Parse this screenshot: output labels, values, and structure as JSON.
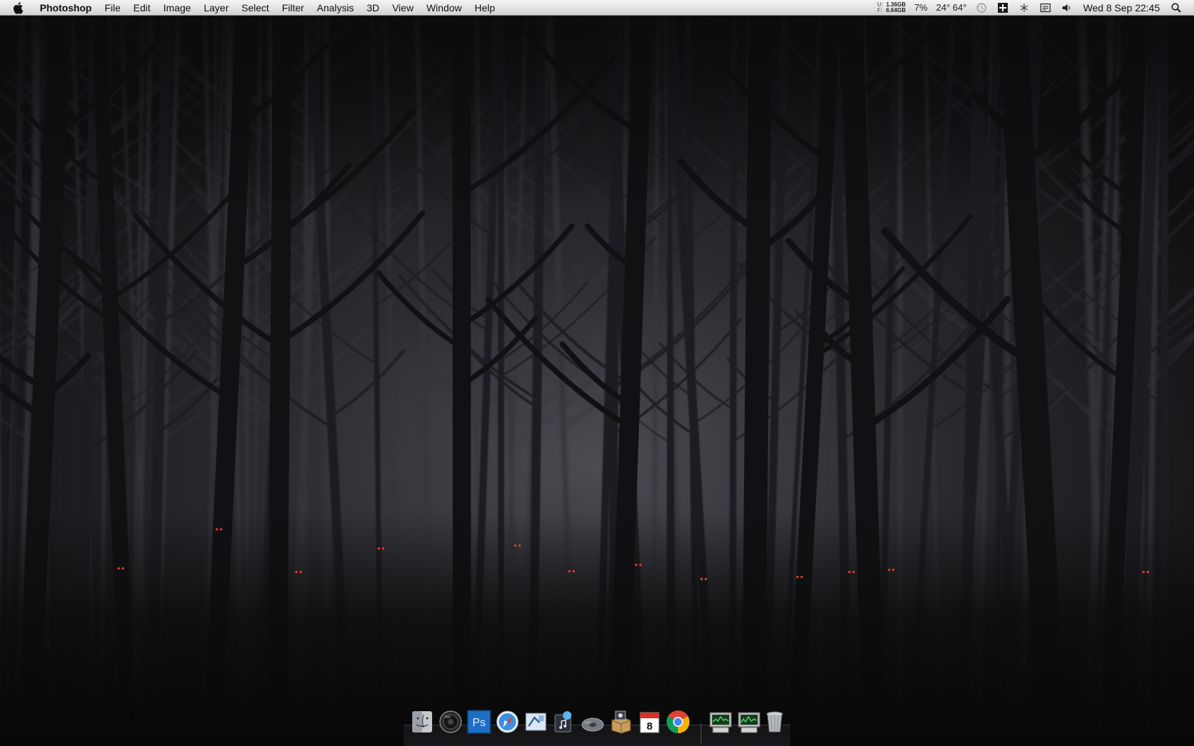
{
  "menubar": {
    "app_name": "Photoshop",
    "menus": [
      "File",
      "Edit",
      "Image",
      "Layer",
      "Select",
      "Filter",
      "Analysis",
      "3D",
      "View",
      "Window",
      "Help"
    ],
    "status": {
      "memory": {
        "label_used": "U:",
        "label_free": "F:",
        "used": "1.36GB",
        "free": "6.64GB"
      },
      "cpu": "7%",
      "temperatures": "24° 64°",
      "clock": "Wed 8 Sep  22:45"
    }
  },
  "icons": {
    "apple_menu": "apple-icon",
    "time_machine": "time-machine-icon",
    "menu_extra": "menu-extra-icon",
    "bluetooth": "bluetooth-icon",
    "input_menu": "input-menu-icon",
    "volume": "volume-icon",
    "spotlight": "spotlight-icon"
  },
  "dock": {
    "items": [
      {
        "name": "finder",
        "icon": "finder-icon"
      },
      {
        "name": "speaker",
        "icon": "speaker-icon"
      },
      {
        "name": "photoshop",
        "icon": "photoshop-icon",
        "label": "Ps"
      },
      {
        "name": "safari",
        "icon": "safari-icon"
      },
      {
        "name": "mail",
        "icon": "mail-icon"
      },
      {
        "name": "itunes",
        "icon": "itunes-icon"
      },
      {
        "name": "disc",
        "icon": "disc-icon"
      },
      {
        "name": "installer",
        "icon": "installer-icon"
      },
      {
        "name": "ical",
        "icon": "calendar-icon",
        "label": "8"
      },
      {
        "name": "chrome",
        "icon": "chrome-icon"
      },
      {
        "name": "monitor-1",
        "icon": "activity-monitor-icon"
      },
      {
        "name": "monitor-2",
        "icon": "activity-monitor-icon"
      },
      {
        "name": "trash",
        "icon": "trash-icon"
      }
    ]
  },
  "colors": {
    "menubar_top": "#f4f4f4",
    "menubar_bottom": "#d2d2d2",
    "photoshop_blue": "#1d6fc4",
    "eyes": "#ff3a2a"
  }
}
